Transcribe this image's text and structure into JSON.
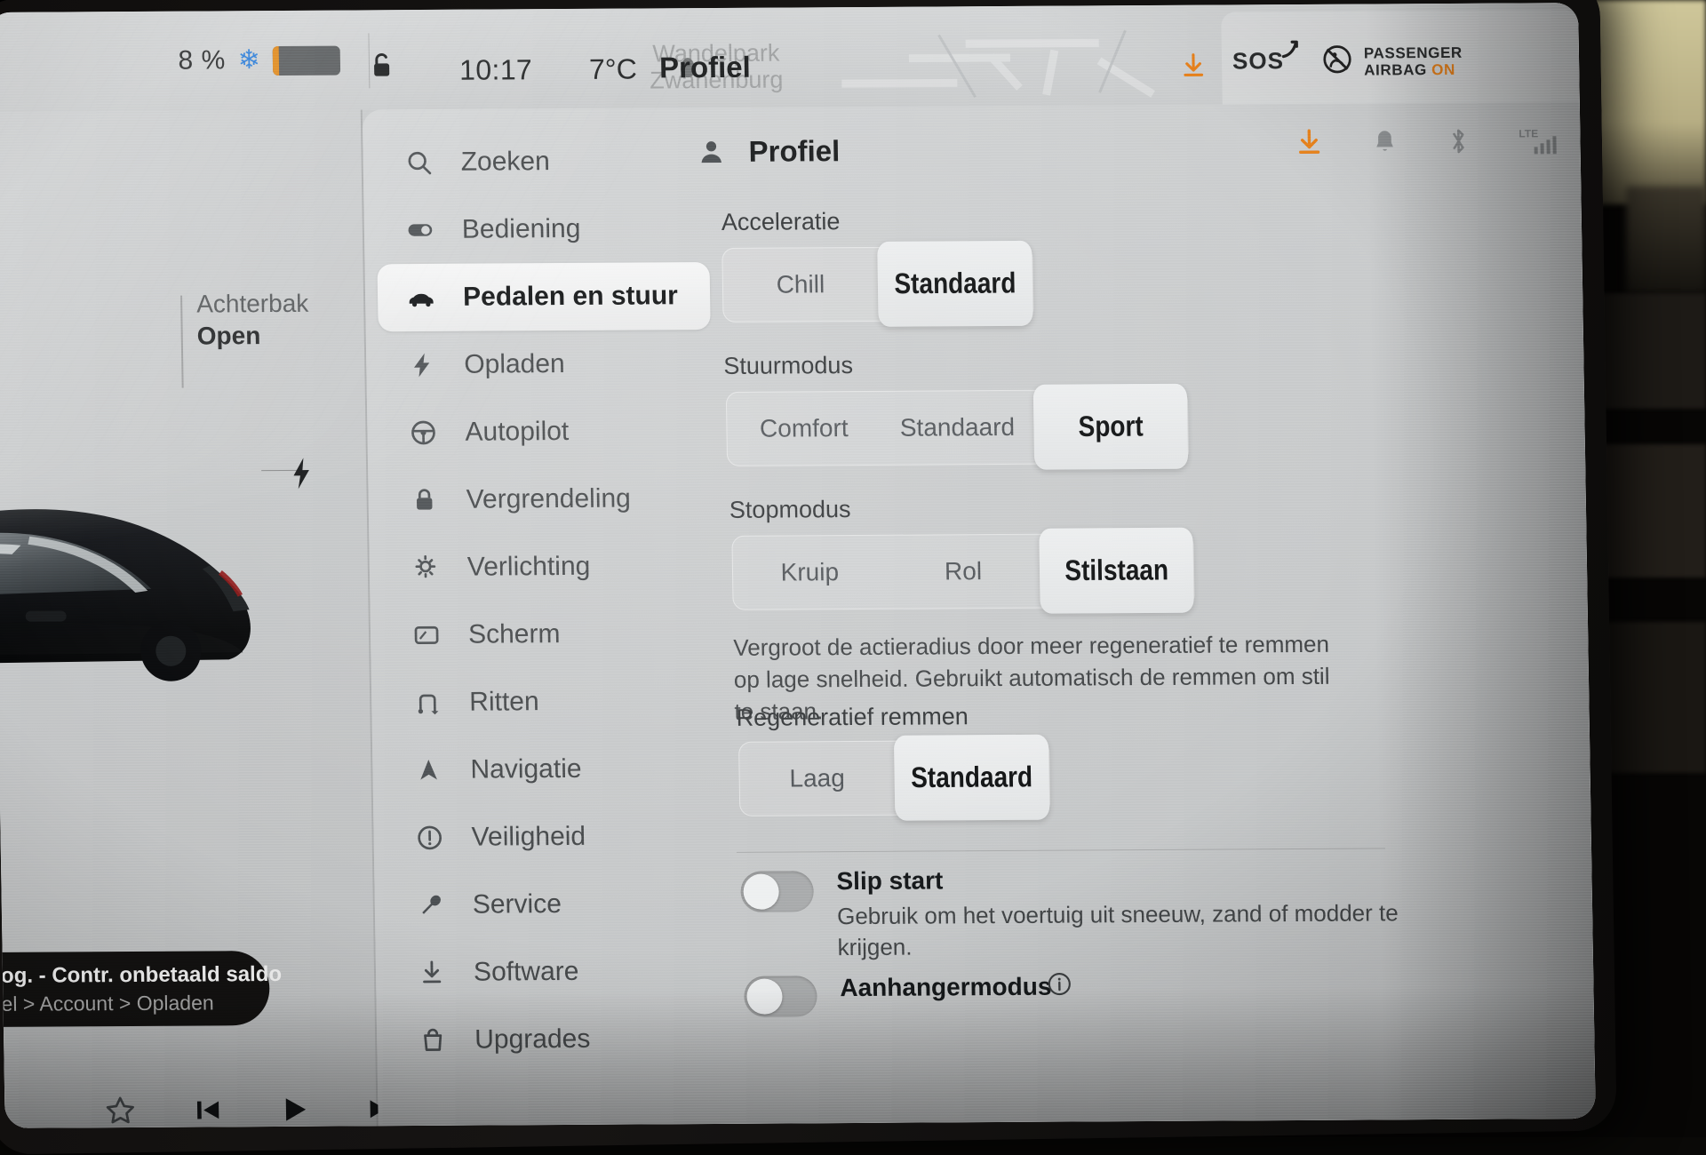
{
  "statusbar": {
    "battery_percent": "8 %",
    "climate_icon": "snowflake-icon",
    "lock_icon": "unlocked-padlock-icon",
    "clock": "10:17",
    "temperature": "7°C",
    "map_label_line1": "Wandelpark",
    "map_label_line2": "Zwanenburg",
    "title": "Profiel",
    "download_icon": "download-arrow-icon",
    "sos_label": "SOS",
    "airbag_line1": "PASSENGER",
    "airbag_line2": "AIRBAG",
    "airbag_state": "ON",
    "accent_orange": "#e8821c"
  },
  "vehicle_panel": {
    "trunk_label": "Achterbak",
    "trunk_state": "Open",
    "charge_port_icon": "lightning-bolt-icon",
    "toast": {
      "line1": "og. - Contr. onbetaald saldo",
      "line2": "el > Account > Opladen"
    },
    "media": {
      "favorite_icon": "star-icon",
      "previous_icon": "skip-previous-icon",
      "play_icon": "play-icon",
      "next_icon": "skip-next-icon"
    }
  },
  "sidebar": {
    "items": [
      {
        "label": "Zoeken",
        "icon": "search-icon",
        "active": false
      },
      {
        "label": "Bediening",
        "icon": "toggle-icon",
        "active": false
      },
      {
        "label": "Pedalen en stuur",
        "icon": "car-icon",
        "active": true
      },
      {
        "label": "Opladen",
        "icon": "bolt-icon",
        "active": false
      },
      {
        "label": "Autopilot",
        "icon": "steering-wheel-icon",
        "active": false
      },
      {
        "label": "Vergrendeling",
        "icon": "lock-icon",
        "active": false
      },
      {
        "label": "Verlichting",
        "icon": "light-bulb-icon",
        "active": false
      },
      {
        "label": "Scherm",
        "icon": "display-icon",
        "active": false
      },
      {
        "label": "Ritten",
        "icon": "route-icon",
        "active": false
      },
      {
        "label": "Navigatie",
        "icon": "navigation-arrow-icon",
        "active": false
      },
      {
        "label": "Veiligheid",
        "icon": "alert-circle-icon",
        "active": false
      },
      {
        "label": "Service",
        "icon": "wrench-icon",
        "active": false
      },
      {
        "label": "Software",
        "icon": "download-icon",
        "active": false
      },
      {
        "label": "Upgrades",
        "icon": "shopping-bag-icon",
        "active": false
      }
    ]
  },
  "content": {
    "header": {
      "title": "Profiel",
      "profile_icon": "person-icon",
      "icons": [
        {
          "name": "download-arrow-icon",
          "color": "#e8821c"
        },
        {
          "name": "bell-icon",
          "color": "#8e9193"
        },
        {
          "name": "bluetooth-icon",
          "color": "#8e9193"
        },
        {
          "name": "lte-signal-icon",
          "color": "#8e9193",
          "label": "LTE"
        }
      ]
    },
    "sections": [
      {
        "title": "Acceleratie",
        "options": [
          "Chill",
          "Standaard"
        ],
        "selected": "Standaard"
      },
      {
        "title": "Stuurmodus",
        "options": [
          "Comfort",
          "Standaard",
          "Sport"
        ],
        "selected": "Sport"
      },
      {
        "title": "Stopmodus",
        "options": [
          "Kruip",
          "Rol",
          "Stilstaan"
        ],
        "selected": "Stilstaan",
        "description": "Vergroot de actieradius door meer regeneratief te remmen op lage snelheid. Gebruikt automatisch de remmen om stil te staan."
      },
      {
        "title": "Regeneratief remmen",
        "options": [
          "Laag",
          "Standaard"
        ],
        "selected": "Standaard"
      }
    ],
    "toggles": [
      {
        "label": "Slip start",
        "description": "Gebruik om het voertuig uit sneeuw, zand of modder te krijgen.",
        "state": "off"
      },
      {
        "label": "Aanhangermodus",
        "description": "",
        "state": "off",
        "info_icon": "info-circle-icon"
      }
    ]
  }
}
